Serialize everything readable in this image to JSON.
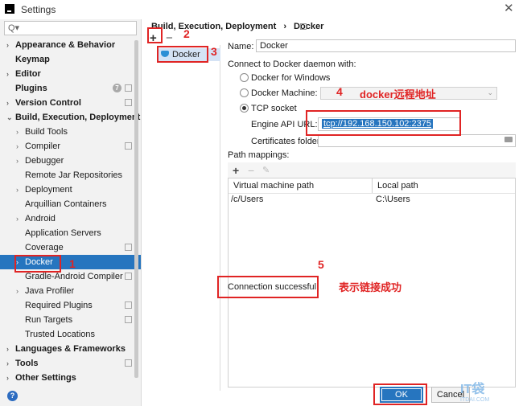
{
  "window": {
    "title": "Settings",
    "close_glyph": "✕"
  },
  "search": {
    "placeholder": "Q▾",
    "value": ""
  },
  "sidebar": {
    "items": [
      {
        "label": "Appearance & Behavior",
        "level": 0,
        "arrow": "›",
        "bold": true
      },
      {
        "label": "Keymap",
        "level": 0,
        "arrow": "",
        "bold": true
      },
      {
        "label": "Editor",
        "level": 0,
        "arrow": "›",
        "bold": true
      },
      {
        "label": "Plugins",
        "level": 0,
        "arrow": "",
        "bold": true
      },
      {
        "label": "Version Control",
        "level": 0,
        "arrow": "›",
        "bold": true
      },
      {
        "label": "Build, Execution, Deployment",
        "level": 0,
        "arrow": "⌄",
        "bold": true
      },
      {
        "label": "Build Tools",
        "level": 1,
        "arrow": "›",
        "bold": false
      },
      {
        "label": "Compiler",
        "level": 1,
        "arrow": "›",
        "bold": false
      },
      {
        "label": "Debugger",
        "level": 1,
        "arrow": "›",
        "bold": false
      },
      {
        "label": "Remote Jar Repositories",
        "level": 1,
        "arrow": "",
        "bold": false
      },
      {
        "label": "Deployment",
        "level": 1,
        "arrow": "›",
        "bold": false
      },
      {
        "label": "Arquillian Containers",
        "level": 1,
        "arrow": "",
        "bold": false
      },
      {
        "label": "Android",
        "level": 1,
        "arrow": "›",
        "bold": false
      },
      {
        "label": "Application Servers",
        "level": 1,
        "arrow": "",
        "bold": false
      },
      {
        "label": "Coverage",
        "level": 1,
        "arrow": "",
        "bold": false
      },
      {
        "label": "Docker",
        "level": 1,
        "arrow": "›",
        "bold": false,
        "selected": true
      },
      {
        "label": "Gradle-Android Compiler",
        "level": 1,
        "arrow": "",
        "bold": false
      },
      {
        "label": "Java Profiler",
        "level": 1,
        "arrow": "›",
        "bold": false
      },
      {
        "label": "Required Plugins",
        "level": 1,
        "arrow": "",
        "bold": false
      },
      {
        "label": "Run Targets",
        "level": 1,
        "arrow": "",
        "bold": false
      },
      {
        "label": "Trusted Locations",
        "level": 1,
        "arrow": "",
        "bold": false
      },
      {
        "label": "Languages & Frameworks",
        "level": 0,
        "arrow": "›",
        "bold": true
      },
      {
        "label": "Tools",
        "level": 0,
        "arrow": "›",
        "bold": true
      },
      {
        "label": "Other Settings",
        "level": 0,
        "arrow": "›",
        "bold": true
      }
    ],
    "plugins_badge": "7"
  },
  "breadcrumb": {
    "parent": "Build, Execution, Deployment",
    "sep": "›",
    "current": "Docker"
  },
  "docker_list": {
    "add_glyph": "+",
    "remove_glyph": "−",
    "item": "Docker"
  },
  "form": {
    "name_label": "Name:",
    "name_value": "Docker",
    "connect_label": "Connect to Docker daemon with:",
    "radio_windows": "Docker for Windows",
    "radio_machine": "Docker Machine:",
    "radio_tcp": "TCP socket",
    "engine_label": "Engine API URL:",
    "engine_value": "tcp://192.168.150.102:2375",
    "certs_label": "Certificates folder:",
    "certs_value": "",
    "path_mappings_label": "Path mappings:",
    "table": {
      "headers": [
        "Virtual machine path",
        "Local path"
      ],
      "rows": [
        [
          "/c/Users",
          "C:\\Users"
        ]
      ]
    },
    "status": "Connection successful"
  },
  "buttons": {
    "ok": "OK",
    "cancel": "Cancel"
  },
  "annotations": {
    "n1": "1",
    "n2": "2",
    "n3": "3",
    "n4": "4",
    "n5": "5",
    "remote_text": "docker远程地址",
    "success_text": "表示链接成功"
  },
  "watermark": {
    "big": "IT袋",
    "small": "ITDAI.COM"
  },
  "colors": {
    "accent": "#2675bf",
    "annotation": "#e02424",
    "sidebar_bg": "#f2f2f2"
  }
}
